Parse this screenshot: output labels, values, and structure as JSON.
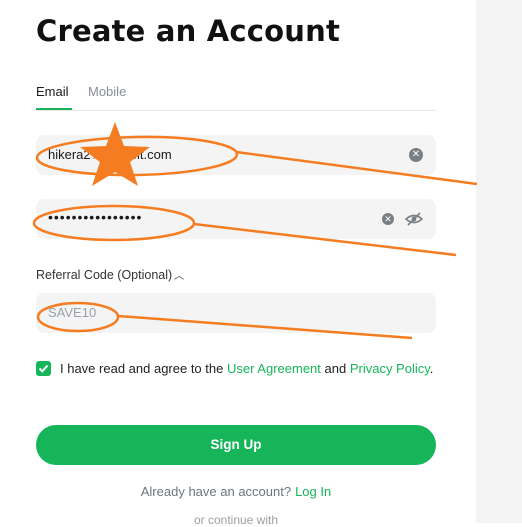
{
  "page": {
    "title": "Create an Account"
  },
  "tabs": [
    {
      "label": "Email",
      "active": true
    },
    {
      "label": "Mobile",
      "active": false
    }
  ],
  "form": {
    "email_value": "hikera2★okexbit.com",
    "password_mask": "••••••••••••••••",
    "referral_label": "Referral Code (Optional)",
    "referral_value": "SAVE10"
  },
  "agreement": {
    "checked": true,
    "text_before": "I have read and agree to the ",
    "user_agreement": "User Agreement",
    "and": " and ",
    "privacy": "Privacy Policy",
    "period": "."
  },
  "actions": {
    "signup_label": "Sign Up",
    "have_account": "Already have an account?",
    "login_label": "Log In",
    "cutoff_text": "or continue with"
  },
  "icons": {
    "clear": "clear-icon",
    "eye": "eye-hidden-icon",
    "chevron": "chevron-up-icon",
    "check": "checkmark-icon"
  },
  "colors": {
    "accent": "#16b55a",
    "annotation": "#f57c20",
    "field_bg": "#f4f4f5"
  }
}
